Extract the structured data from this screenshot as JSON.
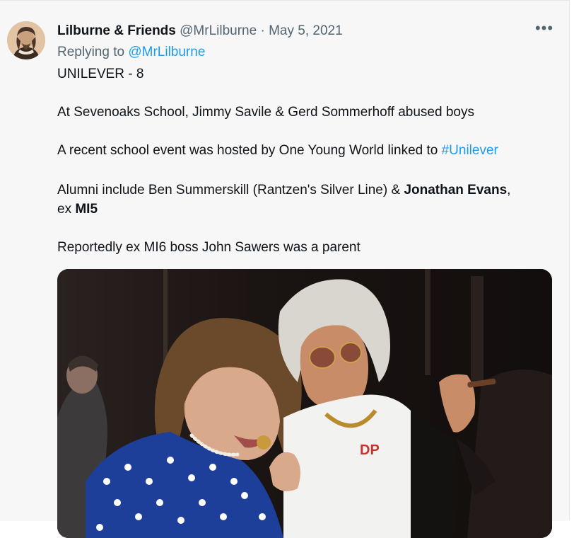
{
  "tweet": {
    "display_name": "Lilburne & Friends",
    "handle": "@MrLilburne",
    "separator": "·",
    "date": "May 5, 2021",
    "more_icon": "more-horizontal-icon",
    "replying_to_label": "Replying to",
    "replying_to_handle": "@MrLilburne",
    "lines": {
      "l1": "UNILEVER - 8",
      "l2": "At Sevenoaks School, Jimmy Savile & Gerd Sommerhoff abused boys",
      "l3_text": "A recent school event was hosted by One Young World linked to ",
      "l3_hashtag": "#Unilever",
      "l4_text": "Alumni include Ben Summerskill (Rantzen's Silver Line) & ",
      "l4_bold": "Jonathan Evans",
      "l4_end": ",",
      "l5_text": "ex ",
      "l5_bold": "MI5",
      "l6": "Reportedly ex MI6 boss John Sawers was a parent"
    },
    "photo_shirt_logo": "DP",
    "colors": {
      "link": "#1d9bf0",
      "secondary_text": "#536471",
      "primary_text": "#0f1419"
    }
  }
}
